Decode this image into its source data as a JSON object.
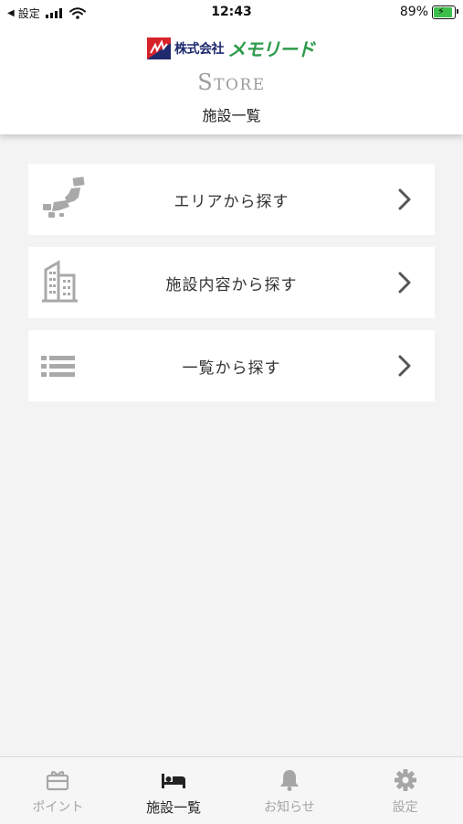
{
  "status_bar": {
    "back_label": "◀",
    "carrier": "設定",
    "time": "12:43",
    "battery": "89%",
    "battery_level": 0.89
  },
  "header": {
    "company_prefix": "株式会社",
    "company_name": "メモリード",
    "store_label": "Store",
    "page_title": "施設一覧"
  },
  "menu": {
    "items": [
      {
        "label": "エリアから探す",
        "icon": "japan-map-icon"
      },
      {
        "label": "施設内容から探す",
        "icon": "building-icon"
      },
      {
        "label": "一覧から探す",
        "icon": "list-icon"
      }
    ]
  },
  "tabbar": {
    "tabs": [
      {
        "label": "ポイント",
        "icon": "gift-card-icon",
        "active": false
      },
      {
        "label": "施設一覧",
        "icon": "bed-icon",
        "active": true
      },
      {
        "label": "お知らせ",
        "icon": "bell-icon",
        "active": false
      },
      {
        "label": "設定",
        "icon": "gear-icon",
        "active": false
      }
    ]
  },
  "colors": {
    "background": "#f3f3f3",
    "icon_gray": "#a9a9a9",
    "chevron": "#555555",
    "active_tab": "#222222",
    "inactive_tab": "#a6a6a6",
    "logo_green": "#2e9b4b",
    "logo_navy": "#1f2a6e",
    "logo_red": "#d8222a"
  }
}
